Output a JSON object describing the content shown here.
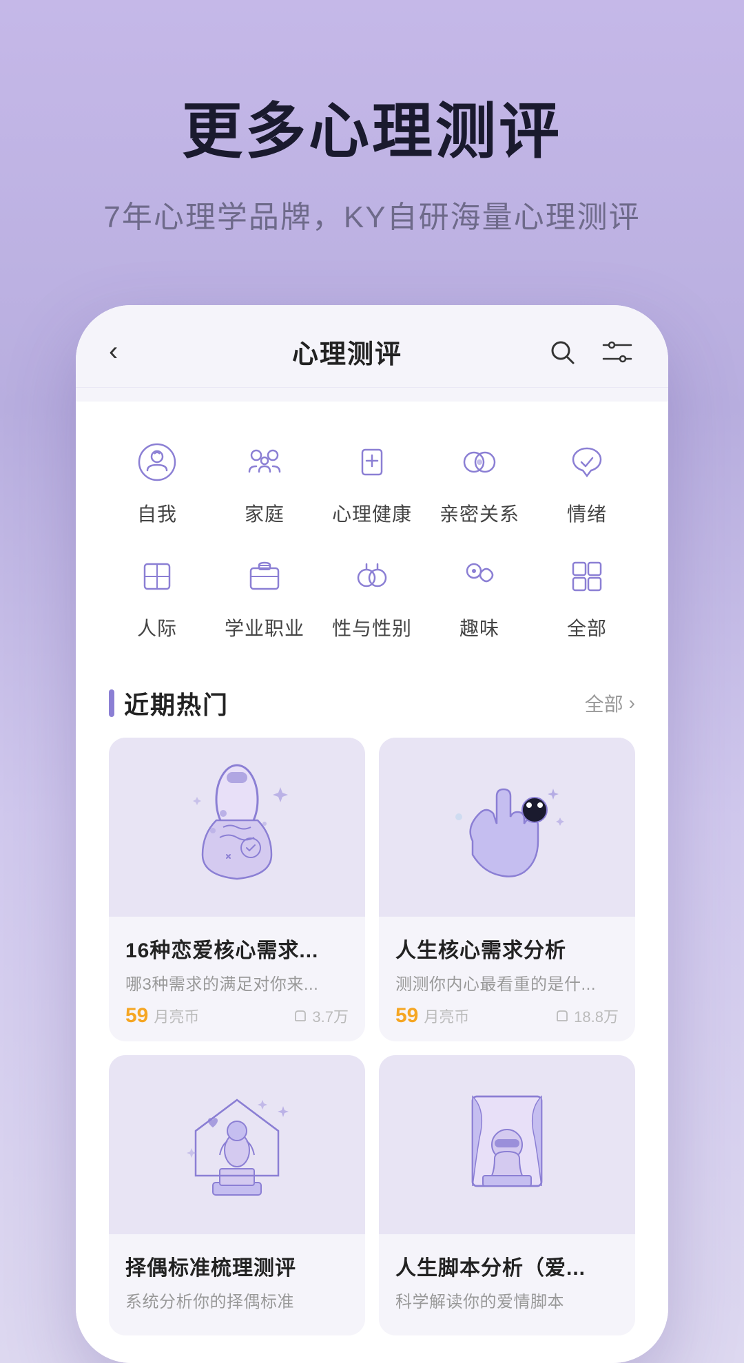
{
  "page": {
    "title": "更多心理测评",
    "subtitle": "7年心理学品牌，KY自研海量心理测评"
  },
  "appHeader": {
    "back": "‹",
    "title": "心理测评"
  },
  "categories": [
    {
      "id": "self",
      "label": "自我",
      "icon": "self"
    },
    {
      "id": "family",
      "label": "家庭",
      "icon": "family"
    },
    {
      "id": "mental",
      "label": "心理健康",
      "icon": "mental"
    },
    {
      "id": "relationship",
      "label": "亲密关系",
      "icon": "relationship"
    },
    {
      "id": "mood",
      "label": "情绪",
      "icon": "mood"
    },
    {
      "id": "social",
      "label": "人际",
      "icon": "social"
    },
    {
      "id": "career",
      "label": "学业职业",
      "icon": "career"
    },
    {
      "id": "gender",
      "label": "性与性别",
      "icon": "gender"
    },
    {
      "id": "fun",
      "label": "趣味",
      "icon": "fun"
    },
    {
      "id": "all",
      "label": "全部",
      "icon": "all"
    }
  ],
  "sectionTitle": "近期热门",
  "sectionMore": "全部",
  "cards": [
    {
      "id": "card1",
      "title": "16种恋爱核心需求...",
      "desc": "哪3种需求的满足对你来...",
      "price": "59",
      "priceUnit": "月亮币",
      "count": "3.7万"
    },
    {
      "id": "card2",
      "title": "人生核心需求分析",
      "desc": "测测你内心最看重的是什...",
      "price": "59",
      "priceUnit": "月亮币",
      "count": "18.8万"
    },
    {
      "id": "card3",
      "title": "择偶标准梳理测评",
      "desc": "系统分析你的择偶标准",
      "price": "",
      "priceUnit": "",
      "count": ""
    },
    {
      "id": "card4",
      "title": "人生脚本分析（爱...",
      "desc": "科学解读你的爱情脚本",
      "price": "",
      "priceUnit": "",
      "count": ""
    }
  ]
}
